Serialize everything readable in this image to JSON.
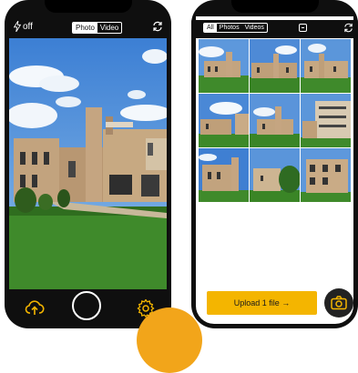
{
  "camera": {
    "flash_label": "off",
    "mode_photo": "Photo",
    "mode_video": "Video"
  },
  "library": {
    "tabs": [
      "All",
      "Photos",
      "Videos"
    ],
    "upload_label": "Upload 1 file →"
  },
  "colors": {
    "accent": "#f4b500",
    "phone_frame": "#0f0f0f",
    "sky": "#4f8fd8",
    "grass": "#3f8a2b",
    "brick": "#b49a78"
  },
  "icons": [
    "lightning-icon",
    "rotate-camera-icon",
    "upload-cloud-icon",
    "shutter-button",
    "gear-icon",
    "select-icon",
    "camera-icon"
  ]
}
